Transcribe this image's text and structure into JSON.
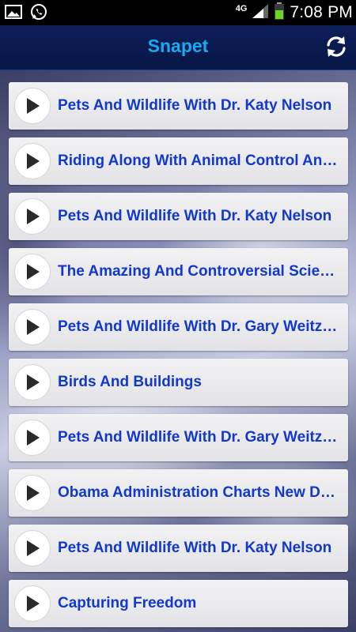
{
  "status_bar": {
    "time": "7:08 PM",
    "network": "4G",
    "icons": [
      "gallery-icon",
      "whatsapp-icon",
      "network-4g-icon",
      "signal-icon",
      "battery-icon"
    ]
  },
  "header": {
    "title": "Snapet",
    "refresh_icon": "refresh-icon",
    "title_color": "#19aaf2"
  },
  "feed": {
    "item_text_color": "#1238cc",
    "items": [
      {
        "title": "Pets And Wildlife With Dr. Katy Nelson"
      },
      {
        "title": "Riding Along With Animal Control And…"
      },
      {
        "title": "Pets And Wildlife With Dr. Katy Nelson"
      },
      {
        "title": "The Amazing And Controversial Scien…"
      },
      {
        "title": "Pets And Wildlife With Dr. Gary Weitz…"
      },
      {
        "title": "Birds And Buildings"
      },
      {
        "title": "Pets And Wildlife With Dr. Gary Weitz…"
      },
      {
        "title": "Obama Administration Charts New De…"
      },
      {
        "title": "Pets And Wildlife With Dr. Katy Nelson"
      },
      {
        "title": "Capturing Freedom"
      }
    ]
  }
}
